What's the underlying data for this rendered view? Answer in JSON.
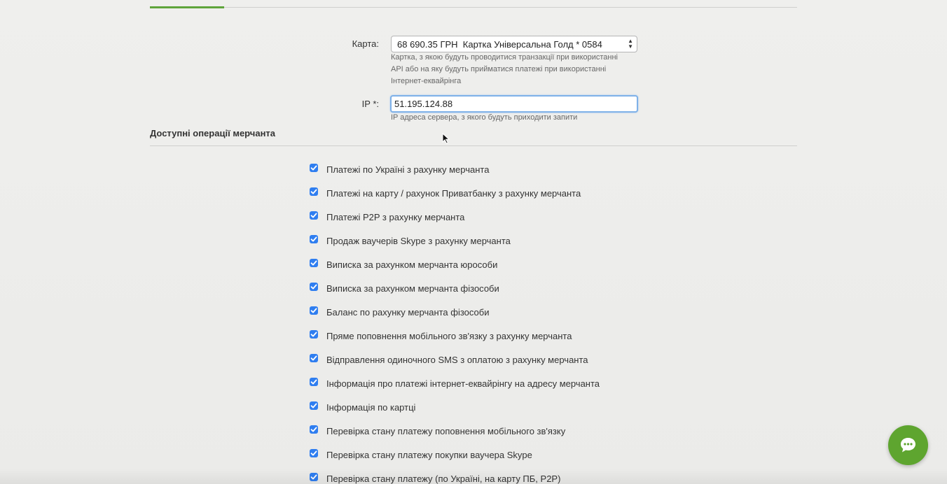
{
  "tabs": {
    "active_indicator_color": "#5fa53b"
  },
  "form": {
    "card": {
      "label": "Карта:",
      "selected": "68 690.35 ГРН  Картка Універсальна Голд * 0584",
      "help_lines": [
        "Картка, з якою будуть проводитися транзакції при використанні",
        "API або на яку будуть прийматися платежі при використанні",
        "Інтернет-еквайрінга"
      ]
    },
    "ip": {
      "label": "IP *:",
      "value": "51.195.124.88",
      "help": "IP адреса сервера, з якого будуть приходити запити"
    }
  },
  "operations": {
    "title": "Доступні операції мерчанта",
    "items": [
      {
        "label": "Платежі по Україні з рахунку мерчанта",
        "checked": true
      },
      {
        "label": "Платежі на карту / рахунок Приватбанку з рахунку мерчанта",
        "checked": true
      },
      {
        "label": "Платежі P2P з рахунку мерчанта",
        "checked": true
      },
      {
        "label": "Продаж ваучерів Skype з рахунку мерчанта",
        "checked": true
      },
      {
        "label": "Виписка за рахунком мерчанта юрособи",
        "checked": true
      },
      {
        "label": "Виписка за рахунком мерчанта фізособи",
        "checked": true
      },
      {
        "label": "Баланс по рахунку мерчанта фізособи",
        "checked": true
      },
      {
        "label": "Пряме поповнення мобільного зв'язку з рахунку мерчанта",
        "checked": true
      },
      {
        "label": "Відправлення одиночного SMS з оплатою з рахунку мерчанта",
        "checked": true
      },
      {
        "label": "Інформація про платежі інтернет-еквайрінгу на адресу мерчанта",
        "checked": true
      },
      {
        "label": "Інформація по картці",
        "checked": true
      },
      {
        "label": "Перевірка стану платежу поповнення мобільного зв'язку",
        "checked": true
      },
      {
        "label": "Перевірка стану платежу покупки ваучера Skype",
        "checked": true
      },
      {
        "label": "Перевірка стану платежу (по Україні, на карту ПБ, P2P)",
        "checked": true
      }
    ]
  },
  "chat": {
    "icon": "chat-bubble-icon",
    "color": "#5ea52f"
  },
  "colors": {
    "checkbox": "#2f7ef0",
    "focus_border": "#7fb1e8"
  }
}
